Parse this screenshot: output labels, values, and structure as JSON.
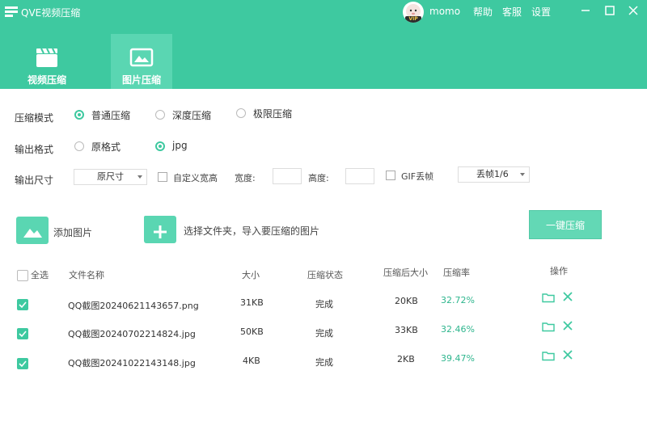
{
  "app": {
    "title": "QVE视频压缩",
    "username": "momo",
    "avatar_badge": "VIP",
    "menu": [
      "帮助",
      "客服",
      "设置"
    ],
    "accent": "#3ec9a0"
  },
  "tabs": [
    {
      "label": "视频压缩",
      "icon": "film-clapper-icon",
      "active": false
    },
    {
      "label": "图片压缩",
      "icon": "image-icon",
      "active": true
    }
  ],
  "settings": {
    "mode_label": "压缩模式",
    "mode_options": [
      "普通压缩",
      "深度压缩",
      "极限压缩"
    ],
    "mode_selected": "普通压缩",
    "format_label": "输出格式",
    "format_options": [
      "原格式",
      "jpg"
    ],
    "format_selected": "jpg",
    "size_label": "输出尺寸",
    "size_select": "原尺寸",
    "custom_size_label": "自定义宽高",
    "width_label": "宽度:",
    "height_label": "高度:",
    "gif_label": "GIF丢帧",
    "gif_select": "丢帧1/6"
  },
  "actions": {
    "add_image": "添加图片",
    "add_folder": "选择文件夹，导入要压缩的图片",
    "compress": "一键压缩"
  },
  "table": {
    "select_all": "全选",
    "columns": [
      "文件名称",
      "大小",
      "压缩状态",
      "压缩后大小",
      "压缩率",
      "操作"
    ],
    "rows": [
      {
        "name": "QQ截图20240621143657.png",
        "size": "31KB",
        "status": "完成",
        "after": "20KB",
        "rate": "32.72%",
        "checked": true
      },
      {
        "name": "QQ截图20240702214824.jpg",
        "size": "50KB",
        "status": "完成",
        "after": "33KB",
        "rate": "32.46%",
        "checked": true
      },
      {
        "name": "QQ截图20241022143148.jpg",
        "size": "4KB",
        "status": "完成",
        "after": "2KB",
        "rate": "39.47%",
        "checked": true
      }
    ]
  }
}
